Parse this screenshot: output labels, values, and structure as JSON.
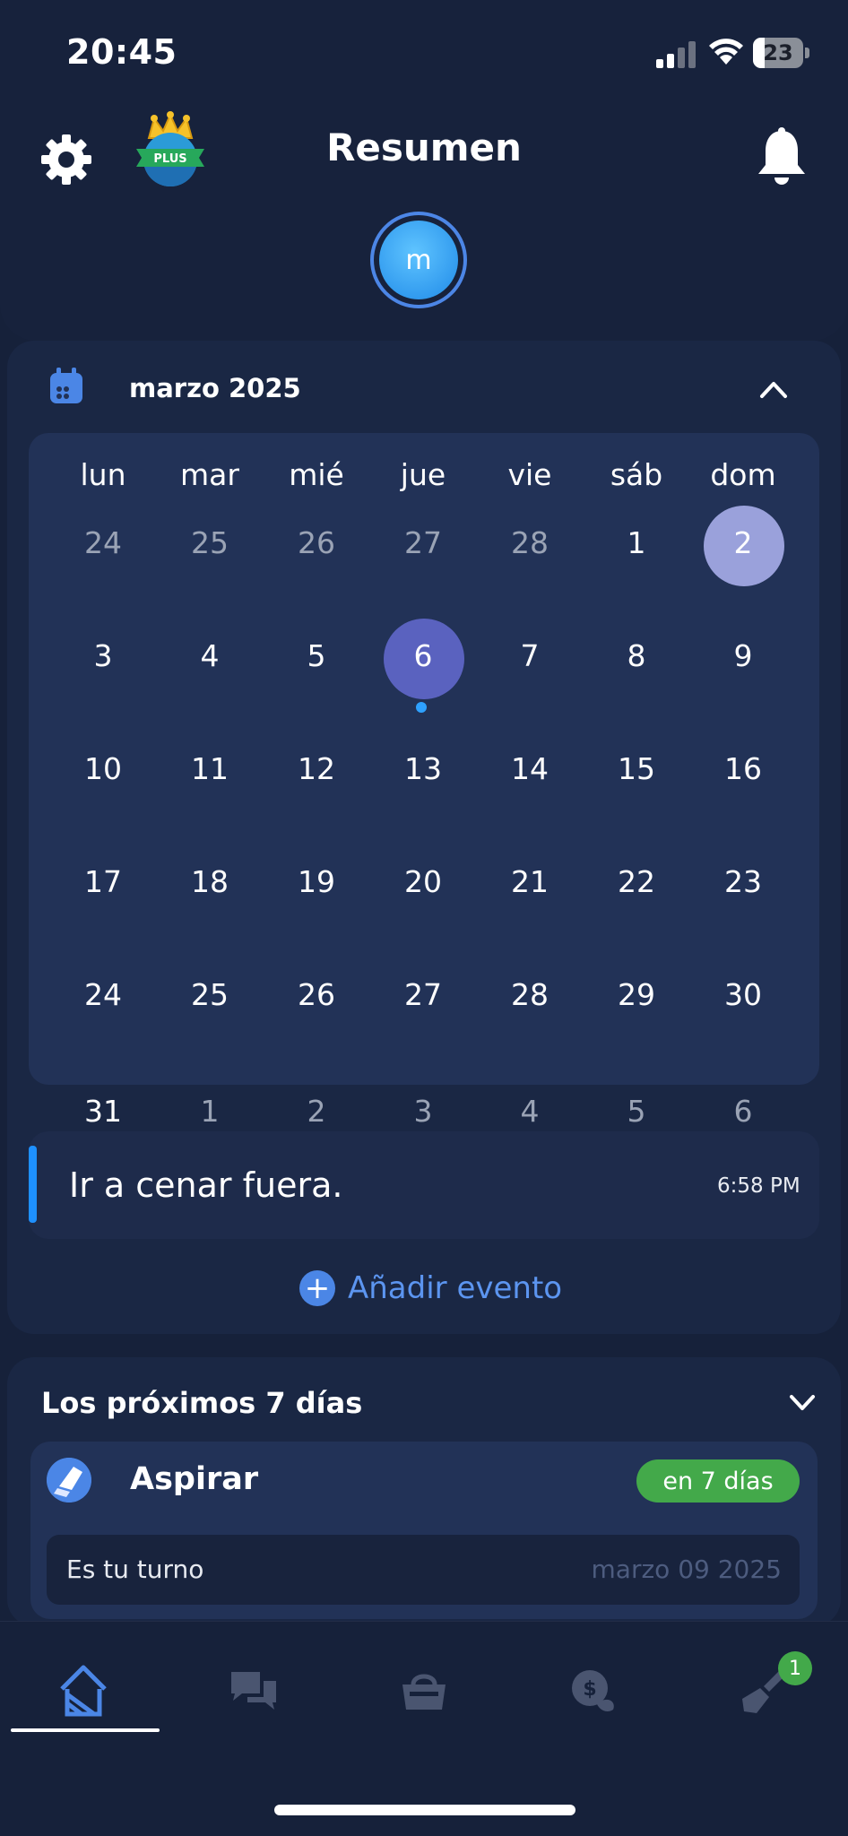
{
  "status_bar": {
    "time": "20:45",
    "battery": "23",
    "battery_level": 0.23
  },
  "header": {
    "title": "Resumen",
    "avatar_initial": "m",
    "plan_badge": "PLUS"
  },
  "calendar": {
    "month_label": "marzo 2025",
    "weekdays": [
      "lun",
      "mar",
      "mié",
      "jue",
      "vie",
      "sáb",
      "dom"
    ],
    "weeks": [
      [
        "24",
        "25",
        "26",
        "27",
        "28",
        "1",
        "2"
      ],
      [
        "3",
        "4",
        "5",
        "6",
        "7",
        "8",
        "9"
      ],
      [
        "10",
        "11",
        "12",
        "13",
        "14",
        "15",
        "16"
      ],
      [
        "17",
        "18",
        "19",
        "20",
        "21",
        "22",
        "23"
      ],
      [
        "24",
        "25",
        "26",
        "27",
        "28",
        "29",
        "30"
      ],
      [
        "31",
        "1",
        "2",
        "3",
        "4",
        "5",
        "6"
      ]
    ],
    "selected_day": "6",
    "highlighted_day": "2"
  },
  "event": {
    "title": "Ir a cenar fuera.",
    "time": "6:58 PM",
    "add_label": "Añadir evento"
  },
  "next_days": {
    "title": "Los próximos 7 días",
    "task": {
      "name": "Aspirar",
      "badge": "en 7 días",
      "turn": "Es tu turno",
      "date": "marzo 09 2025"
    }
  },
  "bottom_nav": {
    "chores_badge": "1"
  },
  "colors": {
    "background": "#16213a",
    "card": "#1a2744",
    "accent": "#4b86e6",
    "today": "#5a62bf",
    "success": "#43a94a"
  }
}
